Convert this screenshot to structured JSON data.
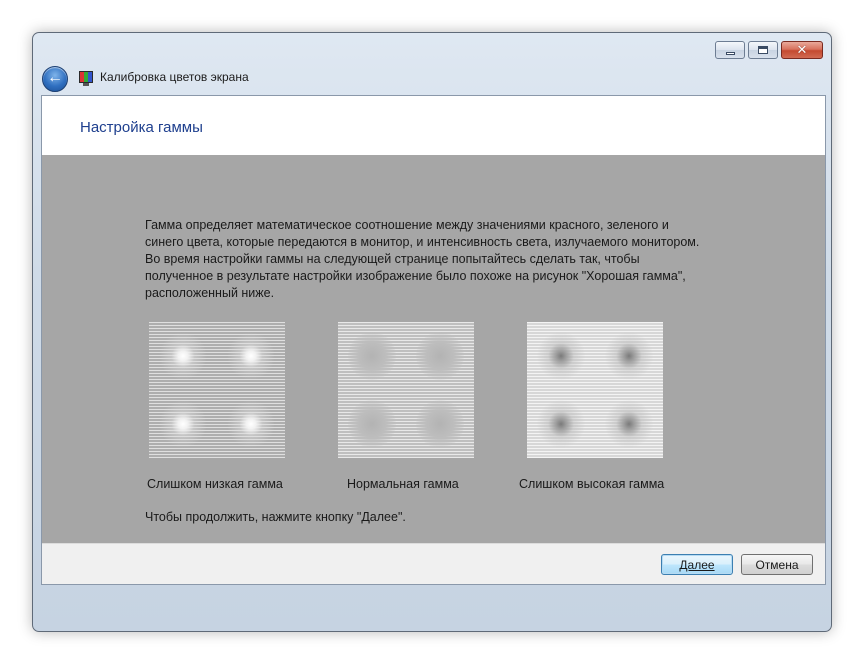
{
  "window": {
    "title": "Калибровка цветов экрана"
  },
  "caption_buttons": {
    "minimize_icon": "minimize-icon",
    "maximize_icon": "maximize-icon",
    "close_glyph": "✕"
  },
  "header": {
    "page_title": "Настройка гаммы"
  },
  "main": {
    "description_1": "Гамма определяет математическое соотношение между значениями красного, зеленого и синего цвета, которые передаются в монитор, и интенсивность света, излучаемого монитором.",
    "description_2": "Во время настройки гаммы на следующей странице попытайтесь сделать так, чтобы полученное в результате настройки изображение было похоже на рисунок \"Хорошая гамма\", расположенный ниже.",
    "samples": [
      {
        "label": "Слишком низкая гамма"
      },
      {
        "label": "Нормальная гамма"
      },
      {
        "label": "Слишком высокая гамма"
      }
    ],
    "continue_hint": "Чтобы продолжить, нажмите кнопку \"Далее\"."
  },
  "footer": {
    "next_label": "Далее",
    "cancel_label": "Отмена"
  },
  "colors": {
    "title_blue": "#1e3f8e",
    "content_gray": "#a6a6a6"
  }
}
